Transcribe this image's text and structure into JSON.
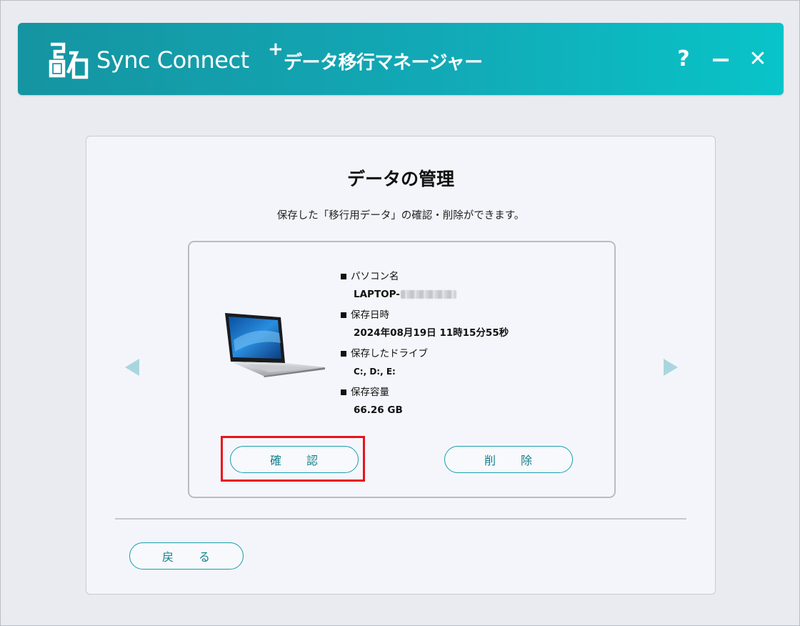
{
  "window": {
    "app_name": "Sync Connect",
    "app_plus": "+",
    "subtitle": "データ移行マネージャー",
    "help_label": "?",
    "close_label": "✕",
    "accent_color": "#12a9b6"
  },
  "panel": {
    "title": "データの管理",
    "description": "保存した「移行用データ」の確認・削除ができます。"
  },
  "card": {
    "pc_name_label": "パソコン名",
    "pc_name_value": "LAPTOP-",
    "saved_datetime_label": "保存日時",
    "saved_datetime_value": "2024年08月19日 11時15分55秒",
    "saved_drives_label": "保存したドライブ",
    "saved_drives_value": "C:, D:, E:",
    "saved_size_label": "保存容量",
    "saved_size_value": "66.26 GB",
    "confirm_label": "確　　認",
    "delete_label": "削　　除"
  },
  "footer": {
    "back_label": "戻　　る"
  }
}
